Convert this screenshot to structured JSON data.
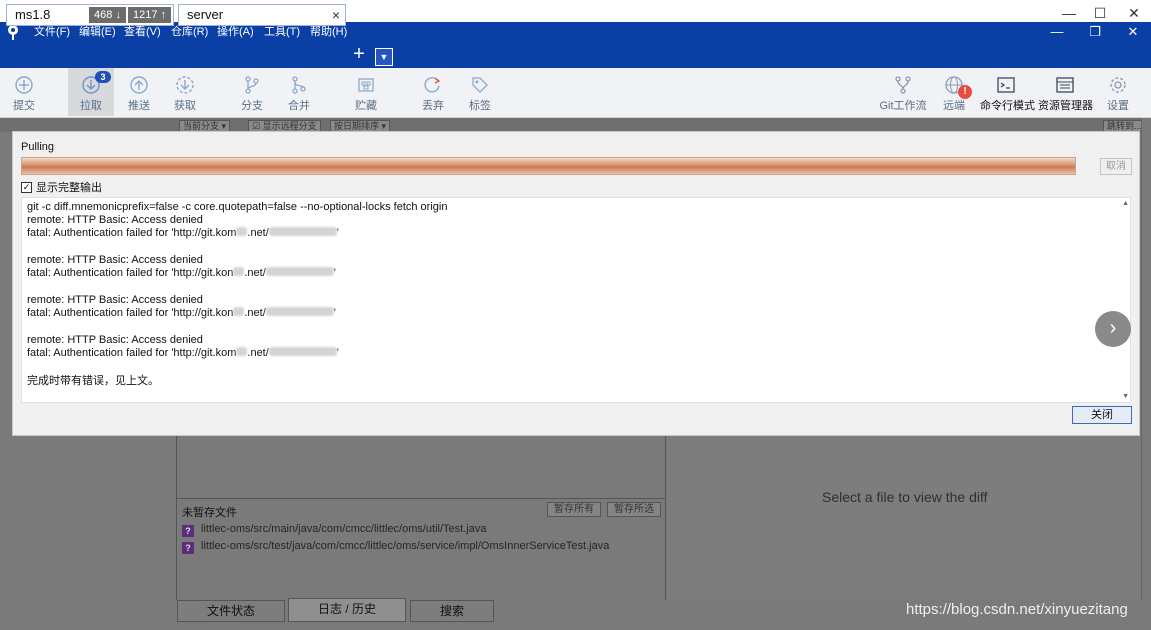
{
  "os": {
    "minimize": "—",
    "maximize": "☐",
    "close": "✕"
  },
  "menubar": {
    "items": [
      "文件(F)",
      "编辑(E)",
      "查看(V)",
      "仓库(R)",
      "操作(A)",
      "工具(T)",
      "帮助(H)"
    ],
    "win_min": "—",
    "win_restore": "❐",
    "win_close": "✕"
  },
  "tabs": [
    {
      "label": "ms1.8",
      "behind": "468 ↓",
      "ahead": "1217 ↑"
    },
    {
      "label": "server",
      "close": "×"
    }
  ],
  "tab_add": "+",
  "tab_dropdown": "▼",
  "toolbar": {
    "commit": "提交",
    "pull": "拉取",
    "pull_badge": "3",
    "push": "推送",
    "fetch": "获取",
    "branch": "分支",
    "merge": "合并",
    "stash": "贮藏",
    "discard": "丢弃",
    "tag": "标签",
    "git_flow": "Git工作流",
    "remote": "远端",
    "remote_alert": "!",
    "terminal": "命令行模式",
    "explorer": "资源管理器",
    "settings": "设置"
  },
  "background": {
    "chips": [
      "当前分支 ▾",
      "☑ 显示远程分支",
      "按日期排序 ▾",
      "跳转到..."
    ],
    "unstaged_title": "未暂存文件",
    "stage_all": "暂存所有",
    "stage_selected": "暂存所选",
    "unstaged_files": [
      "littlec-oms/src/main/java/com/cmcc/littlec/oms/util/Test.java",
      "littlec-oms/src/test/java/com/cmcc/littlec/oms/service/impl/OmsInnerServiceTest.java"
    ],
    "file_status_glyph": "?",
    "diff_hint": "Select a file to view the diff",
    "bottom_tabs": [
      "文件状态",
      "日志 / 历史",
      "搜索"
    ],
    "watermark": "https://blog.csdn.net/xinyuezitang"
  },
  "dialog": {
    "title": "Pulling",
    "progress": 1.0,
    "cancel": "取消",
    "show_full_output": "显示完整输出",
    "show_full_output_checked": "✓",
    "output_lines": [
      "git -c diff.mnemonicprefix=false -c core.quotepath=false --no-optional-locks fetch origin",
      "remote: HTTP Basic: Access denied",
      "fatal: Authentication failed for 'http://git.kom",
      "",
      "remote: HTTP Basic: Access denied",
      "fatal: Authentication failed for 'http://git.kon",
      "",
      "remote: HTTP Basic: Access denied",
      "fatal: Authentication failed for 'http://git.kon",
      "",
      "remote: HTTP Basic: Access denied",
      "fatal: Authentication failed for 'http://git.kom",
      "",
      "完成时带有错误，见上文。"
    ],
    "url_tails": [
      ".net/",
      ".net/",
      ".net/",
      ".net/"
    ],
    "close": "关闭",
    "next": "›"
  }
}
